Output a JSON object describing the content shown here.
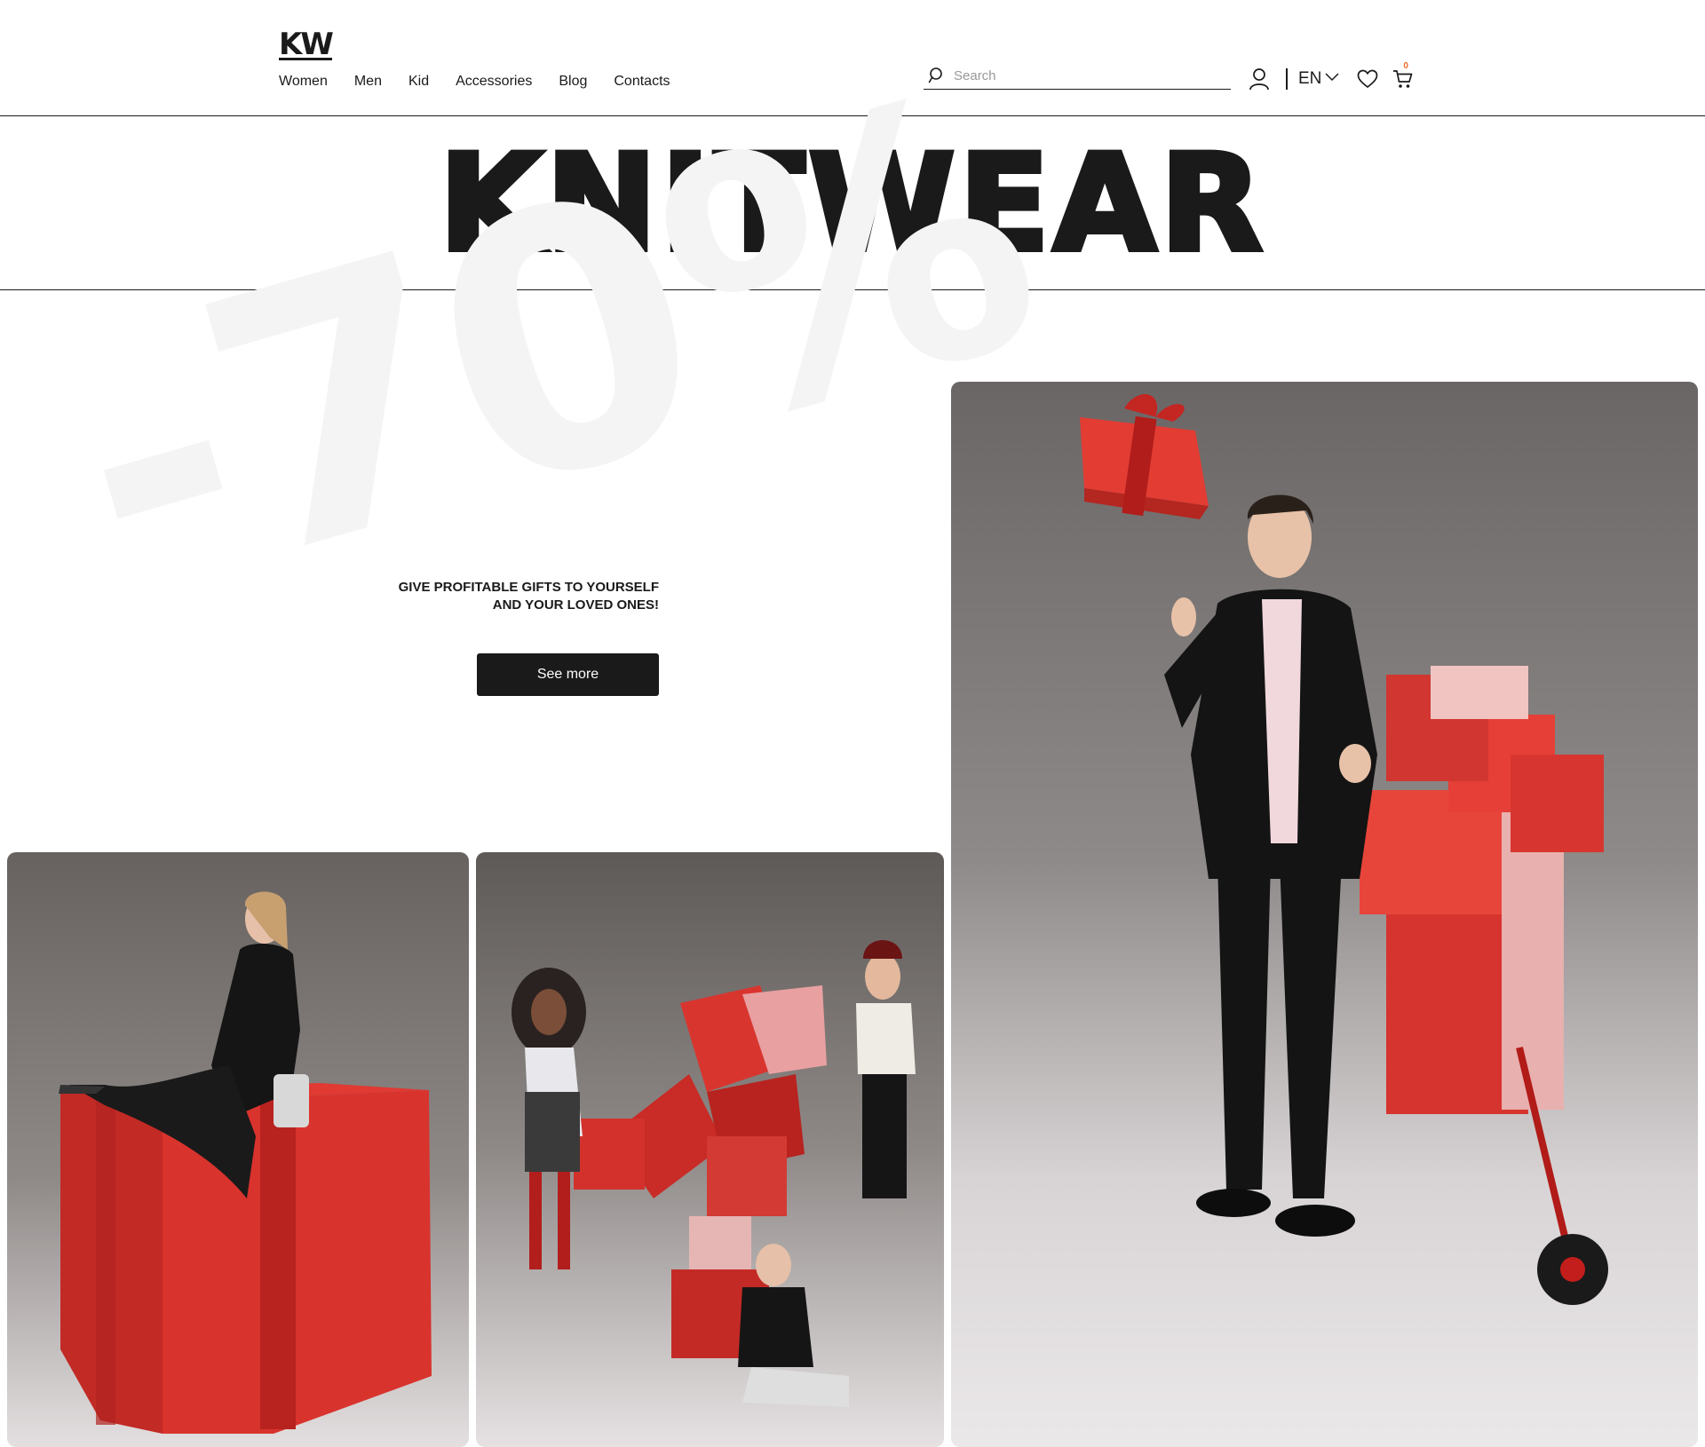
{
  "header": {
    "logo": "KW",
    "nav": [
      "Women",
      "Men",
      "Kid",
      "Accessories",
      "Blog",
      "Contacts"
    ],
    "search_placeholder": "Search",
    "language": "EN",
    "cart_count": "0",
    "icons": [
      "search-icon",
      "user-icon",
      "chevron-down-icon",
      "heart-icon",
      "cart-icon"
    ]
  },
  "hero": {
    "title": "KNITWEAR"
  },
  "promo": {
    "discount": "-70%",
    "text_line1": "GIVE PROFITABLE GIFTS TO YOURSELF",
    "text_line2": "AND YOUR LOVED ONES!",
    "button": "See more"
  },
  "colors": {
    "text": "#1a1a1a",
    "background": "#ffffff",
    "button_bg": "#1a1a1a",
    "gift_red": "#d8322c",
    "cart_badge": "#e8702a",
    "discount_watermark": "#f4f4f4"
  }
}
